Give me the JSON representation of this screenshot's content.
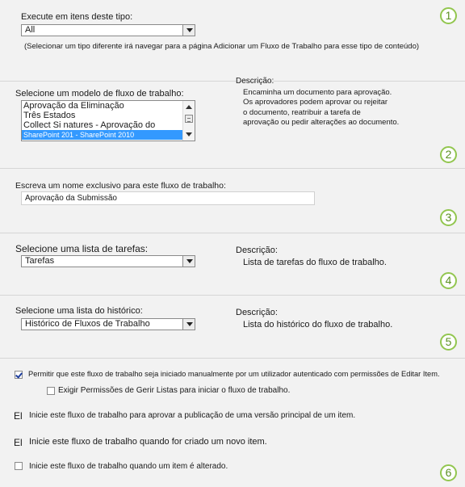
{
  "section1": {
    "label": "Execute em itens deste tipo:",
    "select_value": "All",
    "note": "(Selecionar um tipo diferente irá navegar para a página Adicionar um Fluxo de Trabalho para esse tipo de conteúdo)",
    "badge": "1"
  },
  "section2": {
    "label": "Selecione um modelo de fluxo de trabalho:",
    "list_items": [
      "Aprovação da Eliminação",
      "Três Estados",
      "Collect Si natures - Aprovação do",
      "SharePoint 201 - SharePoint 2010"
    ],
    "desc_label": "Descrição:",
    "desc_lines": [
      "Encaminha um documento para aprovação.",
      "Os aprovadores podem aprovar ou rejeitar",
      "o documento, reatribuir a tarefa de",
      "aprovação ou pedir alterações ao documento."
    ],
    "badge": "2"
  },
  "section3": {
    "label": "Escreva um nome exclusivo para este fluxo de trabalho:",
    "input_value": "Aprovação da Submissão",
    "badge": "3"
  },
  "section4": {
    "label": "Selecione uma lista de tarefas:",
    "select_value": "Tarefas",
    "desc_label": "Descrição:",
    "desc_text": "Lista de tarefas do fluxo de trabalho.",
    "badge": "4"
  },
  "section5": {
    "label": "Selecione uma lista do histórico:",
    "select_value": "Histórico de Fluxos de Trabalho",
    "desc_label": "Descrição:",
    "desc_text": "Lista do histórico do fluxo de trabalho.",
    "badge": "5"
  },
  "section6": {
    "opt_manual": "Permitir que este fluxo de trabalho seja iniciado manualmente por um utilizador autenticado com permissões de Editar Item.",
    "opt_manage_lists": "Exigir Permissões de Gerir Listas para iniciar o fluxo de trabalho.",
    "opt_publish_prefix": "El",
    "opt_publish": "Inicie este fluxo de trabalho para aprovar a publicação de uma versão principal de um item.",
    "opt_create_prefix": "El",
    "opt_create": "Inicie este fluxo de trabalho quando for criado um novo item.",
    "opt_change": "Inicie este fluxo de trabalho quando um item é alterado.",
    "badge": "6"
  }
}
